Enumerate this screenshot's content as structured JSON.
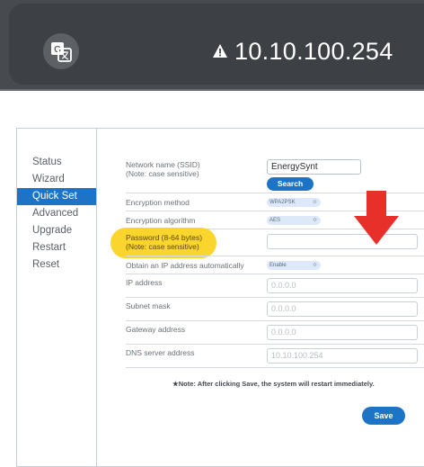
{
  "browser": {
    "url": "10.10.100.254"
  },
  "sidebar": {
    "items": [
      {
        "label": "Status"
      },
      {
        "label": "Wizard"
      },
      {
        "label": "Quick Set"
      },
      {
        "label": "Advanced"
      },
      {
        "label": "Upgrade"
      },
      {
        "label": "Restart"
      },
      {
        "label": "Reset"
      }
    ]
  },
  "form": {
    "ssid_label": "Network name (SSID)",
    "ssid_note": "(Note: case sensitive)",
    "ssid_value": "EnergySynt",
    "search_label": "Search",
    "encryption_method_label": "Encryption method",
    "encryption_method_value": "WPA2PSK",
    "encryption_algorithm_label": "Encryption algorithm",
    "encryption_algorithm_value": "AES",
    "password_label": "Password (8-64 bytes)",
    "password_note": "(Note: case sensitive)",
    "password_value": "",
    "obtain_ip_label": "Obtain an IP address automatically",
    "obtain_ip_value": "Enable",
    "ip_label": "IP address",
    "ip_placeholder": "0.0.0.0",
    "subnet_label": "Subnet mask",
    "subnet_placeholder": "0.0.0.0",
    "gateway_label": "Gateway address",
    "gateway_placeholder": "0.0.0.0",
    "dns_label": "DNS server address",
    "dns_placeholder": "10.10.100.254",
    "note": "★Note: After clicking Save, the system will restart immediately.",
    "save_label": "Save"
  },
  "colors": {
    "accent": "#1d74c6",
    "highlight": "#f9d52e",
    "arrow": "#e8302a"
  }
}
